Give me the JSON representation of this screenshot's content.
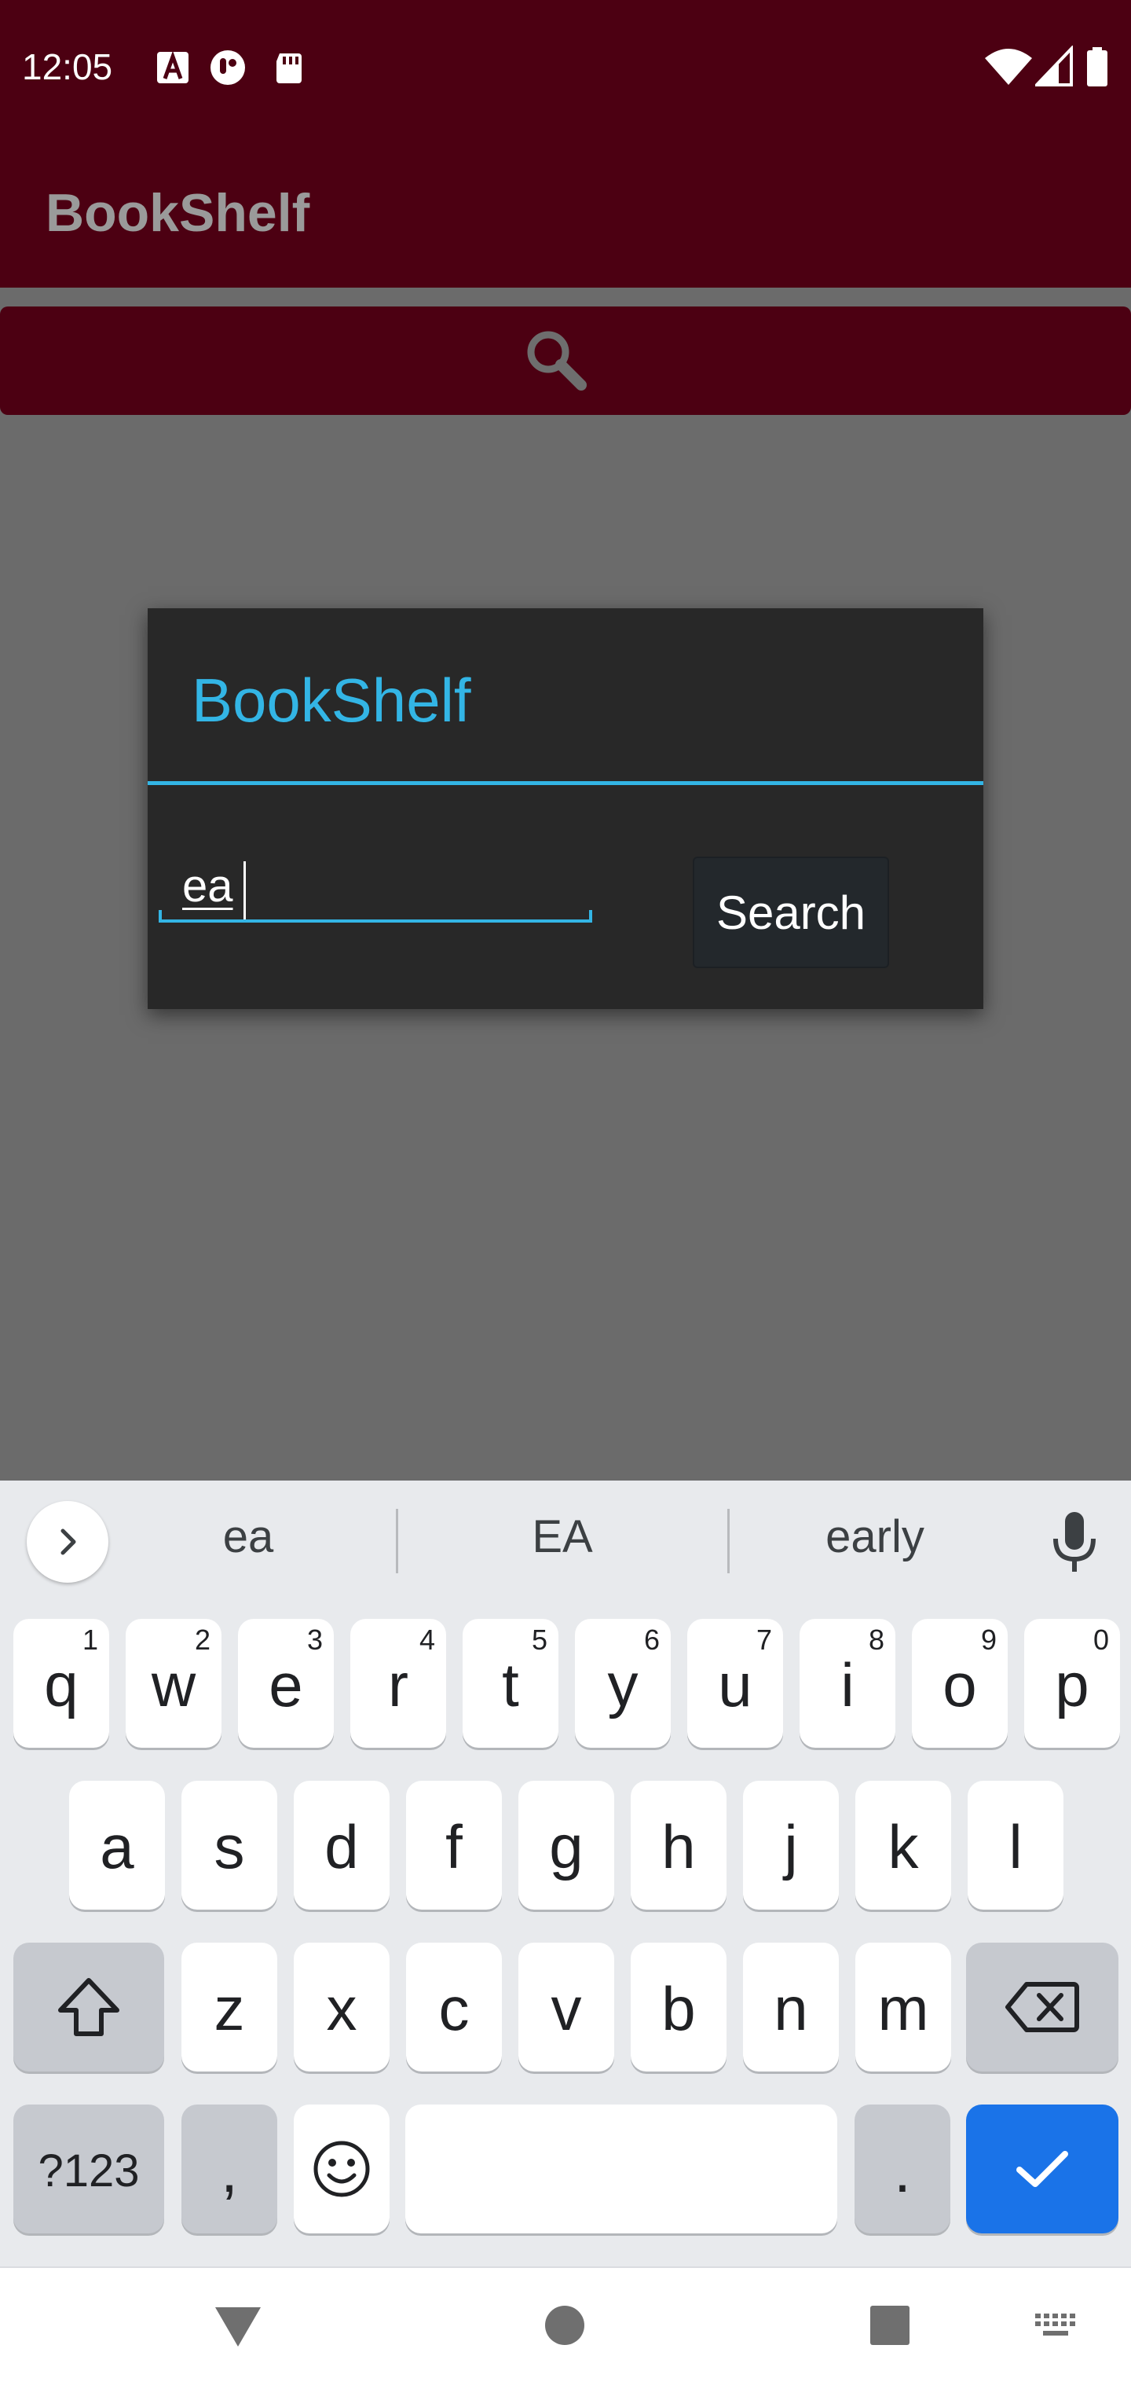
{
  "status_bar": {
    "time": "12:05",
    "left_icons": [
      "a-badge-icon",
      "android-face-icon",
      "sd-card-icon"
    ],
    "right_icons": [
      "wifi-icon",
      "cell-signal-icon",
      "battery-icon"
    ]
  },
  "app": {
    "title": "BookShelf",
    "search_icon": "search-icon",
    "colors": {
      "toolbar": "#4c0012",
      "background": "#6b6b6b"
    }
  },
  "dialog": {
    "title": "BookShelf",
    "input_value": "ea",
    "button_label": "Search",
    "accent": "#33b5e5"
  },
  "keyboard": {
    "suggestions": [
      "ea",
      "EA",
      "early"
    ],
    "rows": [
      [
        {
          "label": "q",
          "hint": "1"
        },
        {
          "label": "w",
          "hint": "2"
        },
        {
          "label": "e",
          "hint": "3"
        },
        {
          "label": "r",
          "hint": "4"
        },
        {
          "label": "t",
          "hint": "5"
        },
        {
          "label": "y",
          "hint": "6"
        },
        {
          "label": "u",
          "hint": "7"
        },
        {
          "label": "i",
          "hint": "8"
        },
        {
          "label": "o",
          "hint": "9"
        },
        {
          "label": "p",
          "hint": "0"
        }
      ],
      [
        {
          "label": "a"
        },
        {
          "label": "s"
        },
        {
          "label": "d"
        },
        {
          "label": "f"
        },
        {
          "label": "g"
        },
        {
          "label": "h"
        },
        {
          "label": "j"
        },
        {
          "label": "k"
        },
        {
          "label": "l"
        }
      ],
      [
        {
          "label": "z"
        },
        {
          "label": "x"
        },
        {
          "label": "c"
        },
        {
          "label": "v"
        },
        {
          "label": "b"
        },
        {
          "label": "n"
        },
        {
          "label": "m"
        }
      ]
    ],
    "symbols_label": "?123",
    "comma_label": ",",
    "period_label": ".",
    "accent": "#1a73e8"
  },
  "nav_bar": {
    "icons": [
      "back-icon",
      "home-icon",
      "recents-icon",
      "keyboard-switch-icon"
    ]
  }
}
